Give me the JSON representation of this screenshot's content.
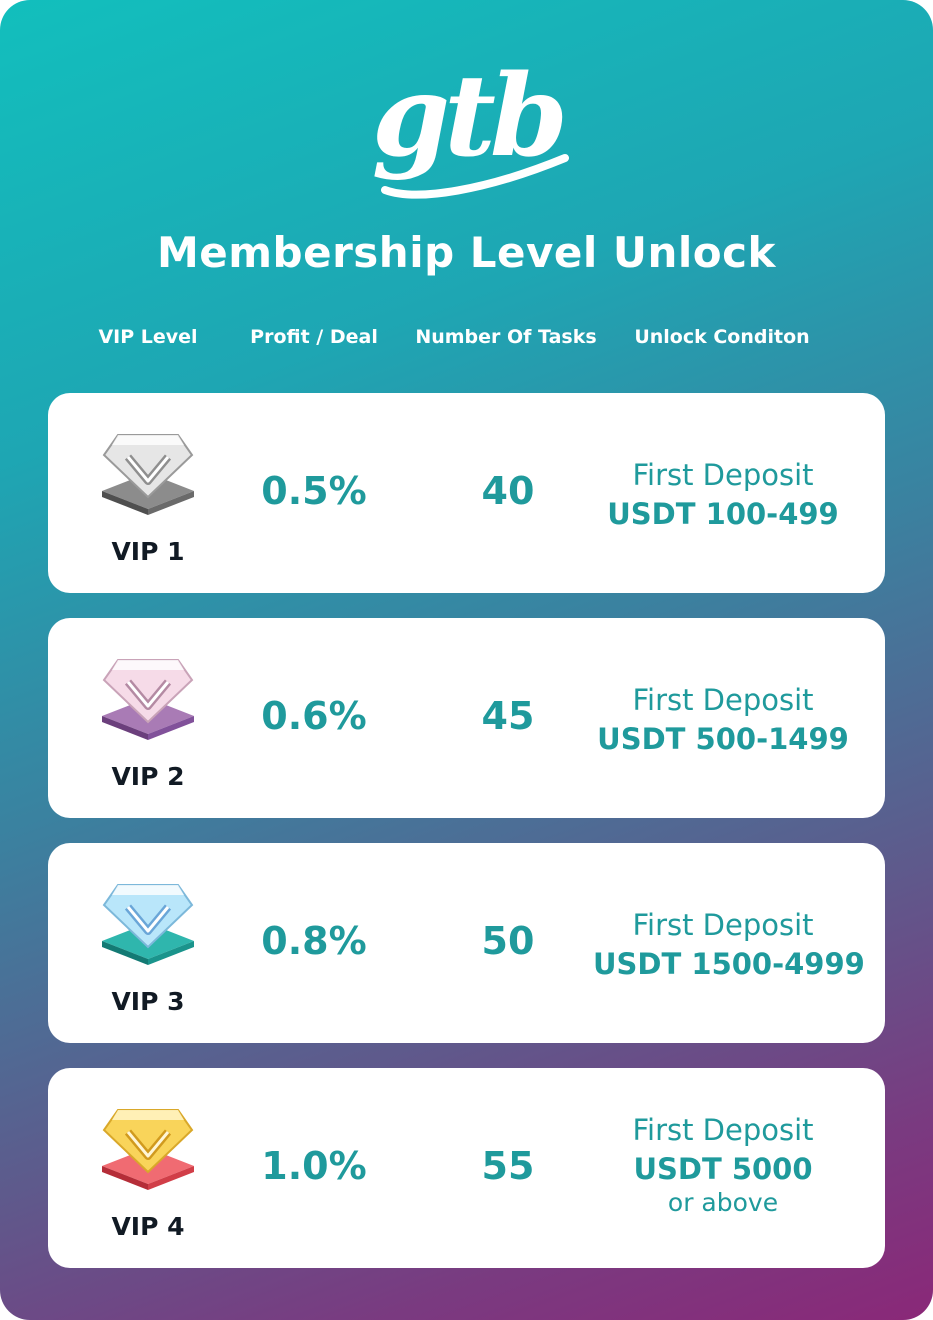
{
  "logo": {
    "text": "gtb"
  },
  "title": "Membership Level Unlock",
  "headers": {
    "vip_level": "VIP Level",
    "profit": "Profit / Deal",
    "tasks": "Number Of Tasks",
    "condition": "Unlock Conditon"
  },
  "colors": {
    "accent": "#1f9a9c",
    "gradient_start": "#12bfbd",
    "gradient_end": "#8a2878"
  },
  "levels": [
    {
      "name": "VIP 1",
      "profit": "0.5%",
      "tasks": "40",
      "condition_line1": "First Deposit",
      "condition_line2": "USDT 100-499",
      "condition_line3": "",
      "icon": "silver-diamond-icon",
      "gem_color": "#d9d9d9",
      "base_color": "#6d6d6d"
    },
    {
      "name": "VIP 2",
      "profit": "0.6%",
      "tasks": "45",
      "condition_line1": "First Deposit",
      "condition_line2": "USDT 500-1499",
      "condition_line3": "",
      "icon": "pink-diamond-icon",
      "gem_color": "#f3cfe0",
      "base_color": "#8a5a9a"
    },
    {
      "name": "VIP 3",
      "profit": "0.8%",
      "tasks": "50",
      "condition_line1": "First Deposit",
      "condition_line2": "USDT 1500-4999",
      "condition_line3": "",
      "icon": "blue-diamond-icon",
      "gem_color": "#a8dcf5",
      "base_color": "#1f9a94"
    },
    {
      "name": "VIP 4",
      "profit": "1.0%",
      "tasks": "55",
      "condition_line1": "First Deposit",
      "condition_line2": "USDT 5000",
      "condition_line3": "or above",
      "icon": "gold-diamond-icon",
      "gem_color": "#f7cd4a",
      "base_color": "#e2474f"
    }
  ]
}
